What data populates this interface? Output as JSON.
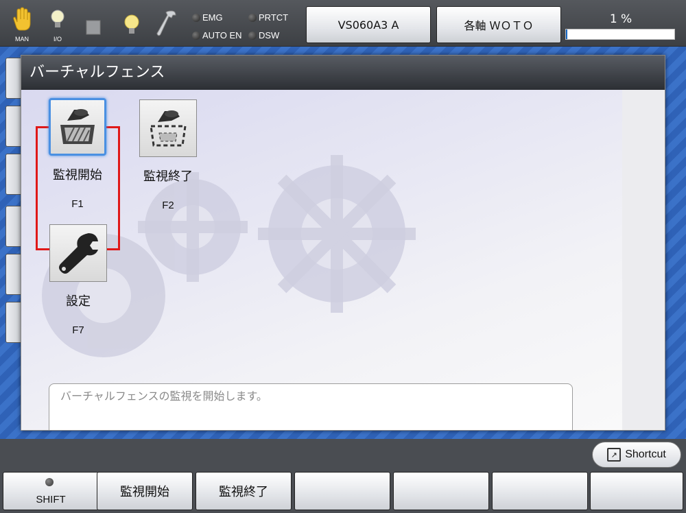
{
  "status_bar": {
    "mode_label": "MAN",
    "io_label": "I/O",
    "indicators": {
      "emg": "EMG",
      "prtct": "PRTCT",
      "auto_en": "AUTO EN",
      "dsw": "DSW"
    },
    "robot_model_button": "VS060A3 A",
    "coordinate_button": "各軸 ＷＯＴＯ",
    "speed_label": "1 %",
    "speed_value_percent": 1,
    "speed_color": "#1565c0"
  },
  "dialog": {
    "title": "バーチャルフェンス",
    "buttons": [
      {
        "label": "監視開始",
        "key": "F1",
        "icon": "robot-fence-start-icon",
        "selected": true
      },
      {
        "label": "監視終了",
        "key": "F2",
        "icon": "robot-fence-stop-icon",
        "selected": false
      },
      {
        "label": "設定",
        "key": "F7",
        "icon": "wrench-icon",
        "selected": false
      }
    ],
    "message": "バーチャルフェンスの監視を開始します。",
    "focus_color": "#e01818"
  },
  "shortcut_button": "Shortcut",
  "function_keys": {
    "shift": "SHIFT",
    "f1": "監視開始",
    "f2": "監視終了",
    "f3": "",
    "f4": "",
    "f5": "",
    "f6": ""
  }
}
